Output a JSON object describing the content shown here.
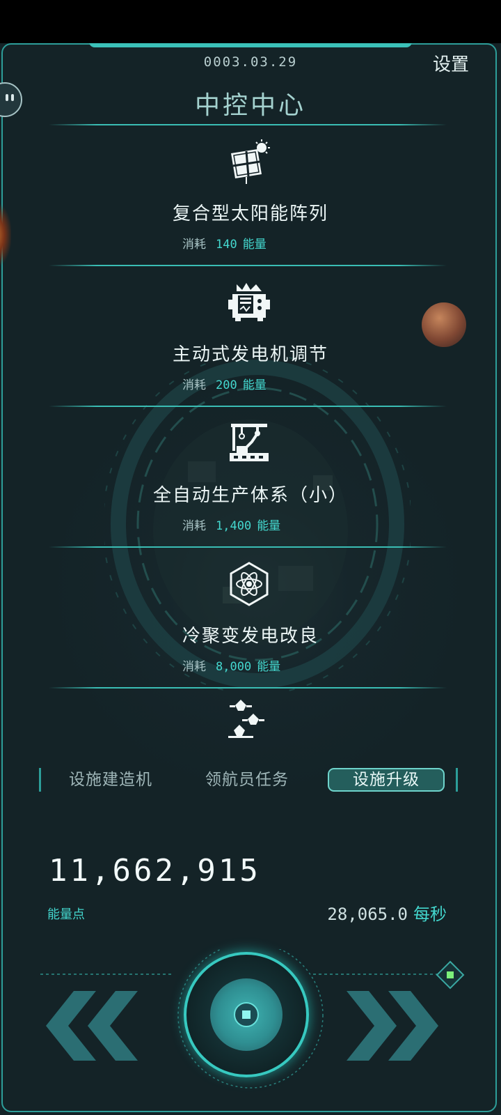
{
  "header": {
    "date": "0003.03.29",
    "settings_label": "设置",
    "title": "中控中心"
  },
  "upgrades": [
    {
      "icon": "solar-panel-icon",
      "name": "复合型太阳能阵列",
      "cost_label": "消耗",
      "cost": "140",
      "unit": "能量"
    },
    {
      "icon": "generator-icon",
      "name": "主动式发电机调节",
      "cost_label": "消耗",
      "cost": "200",
      "unit": "能量"
    },
    {
      "icon": "robotic-arm-icon",
      "name": "全自动生产体系（小）",
      "cost_label": "消耗",
      "cost": "1,400",
      "unit": "能量"
    },
    {
      "icon": "atom-icon",
      "name": "冷聚变发电改良",
      "cost_label": "消耗",
      "cost": "8,000",
      "unit": "能量"
    }
  ],
  "more_icon": "crew-group-icon",
  "tabs": [
    {
      "label": "设施建造机",
      "active": false
    },
    {
      "label": "领航员任务",
      "active": false
    },
    {
      "label": "设施升级",
      "active": true
    }
  ],
  "stats": {
    "energy_total": "11,662,915",
    "energy_label": "能量点",
    "rate_value": "28,065.0",
    "rate_unit": "每秒"
  },
  "controls": {
    "prev_icon": "double-chevron-left-icon",
    "center_icon": "core-button-icon",
    "next_icon": "double-chevron-right-icon",
    "corner_icon": "diamond-marker-icon"
  },
  "colors": {
    "accent": "#3abdb4",
    "panel": "#142227",
    "text_accent": "#44d8cf"
  }
}
